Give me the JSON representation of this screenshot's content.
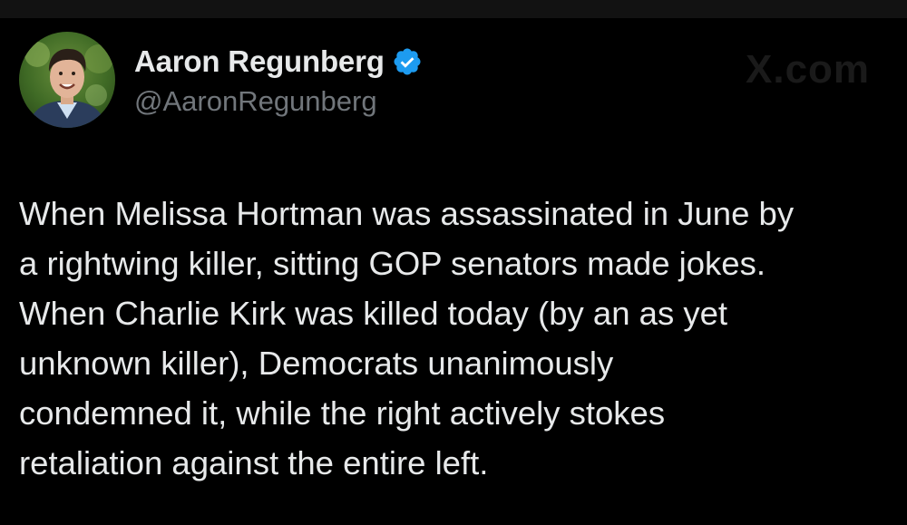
{
  "tweet": {
    "author": {
      "display_name": "Aaron Regunberg",
      "handle": "@AaronRegunberg",
      "avatar_icon": "profile-photo",
      "verified_icon": "verified-badge-icon",
      "verified_color": "#1d9bf0"
    },
    "watermark": "X.com",
    "text": "When Melissa Hortman was assassinated in June by\na rightwing killer, sitting GOP senators made jokes.\nWhen Charlie Kirk was killed today (by an as yet\nunknown killer), Democrats unanimously\ncondemned it, while the right actively stokes\nretaliation against the entire left."
  },
  "colors": {
    "background": "#000000",
    "text": "#e7e9ea",
    "secondary": "#71767b"
  }
}
